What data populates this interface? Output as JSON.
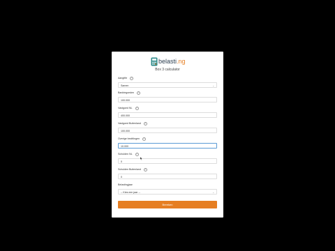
{
  "brand": {
    "name_prefix": "belasti",
    "name_suffix": ".ng",
    "accent": "#e67e22"
  },
  "title": "Box 3 calculator",
  "fields": [
    {
      "label": "Aangifte",
      "value": "Samen",
      "type": "select"
    },
    {
      "label": "Banktegoeden",
      "value": "100.000",
      "type": "input"
    },
    {
      "label": "Vastgoed NL",
      "value": "400.000",
      "type": "input"
    },
    {
      "label": "Vastgoed Buitenland",
      "value": "100.000",
      "type": "input"
    },
    {
      "label": "Overige bezittingen",
      "value": "10.000",
      "type": "input",
      "focused": true
    },
    {
      "label": "Schulden NL",
      "value": "0",
      "type": "input"
    },
    {
      "label": "Schulden Buitenland",
      "value": "0",
      "type": "input"
    },
    {
      "label": "Belastingjaar",
      "value": "-- Kies een jaar --",
      "type": "select"
    }
  ],
  "submit_label": "Bereken"
}
